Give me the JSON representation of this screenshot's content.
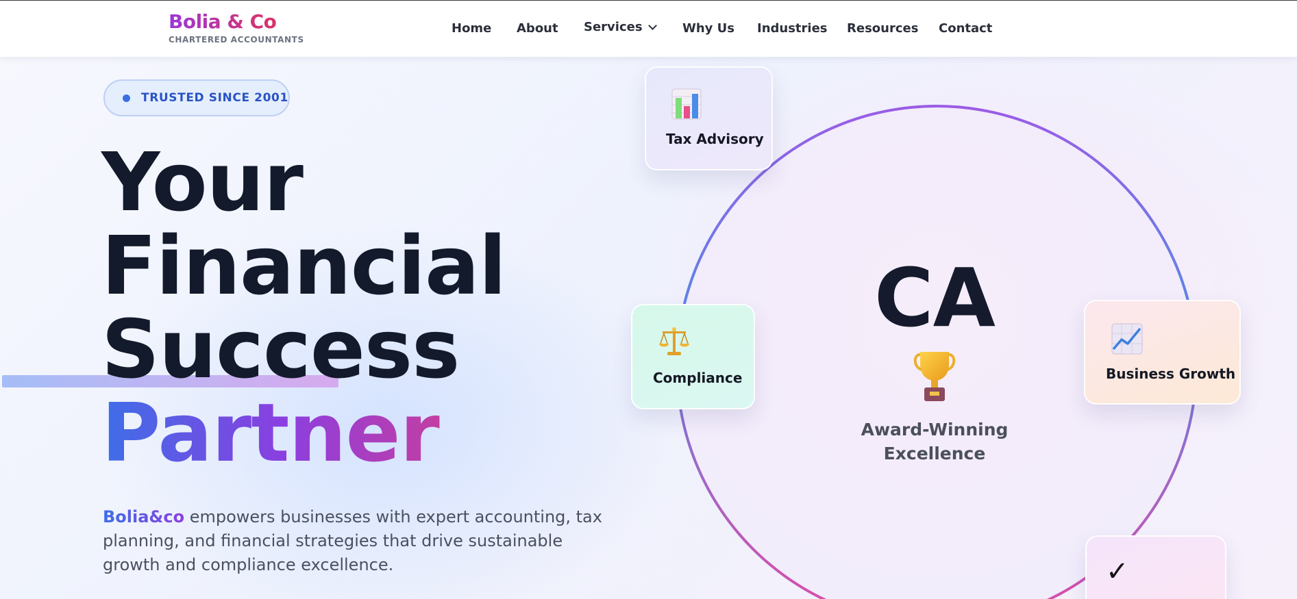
{
  "brand": {
    "name": "Bolia & Co",
    "subtitle": "CHARTERED ACCOUNTANTS"
  },
  "nav": {
    "items": [
      {
        "label": "Home"
      },
      {
        "label": "About"
      },
      {
        "label": "Services",
        "has_dropdown": true
      },
      {
        "label": "Why Us"
      },
      {
        "label": "Industries"
      },
      {
        "label": "Resources"
      },
      {
        "label": "Contact"
      }
    ]
  },
  "hero": {
    "badge": "TRUSTED SINCE 2001",
    "headline": {
      "line1": "Your",
      "line2": "Financial",
      "line3": "Success",
      "line4": "Partner"
    },
    "description": {
      "brand": "Bolia&co",
      "text": " empowers businesses with expert accounting, tax planning, and financial strategies that drive sustainable growth and compliance excellence."
    }
  },
  "visual": {
    "center_title": "CA",
    "center_icon": "trophy-icon",
    "center_caption_line1": "Award-Winning",
    "center_caption_line2": "Excellence",
    "cards": {
      "tax": {
        "label": "Tax Advisory",
        "icon": "bar-chart-icon"
      },
      "compliance": {
        "label": "Compliance",
        "icon": "balance-scale-icon"
      },
      "growth": {
        "label": "Business Growth",
        "icon": "trend-chart-icon"
      },
      "check": {
        "icon": "check-icon",
        "symbol": "✓"
      }
    }
  },
  "colors": {
    "brand_gradient_start": "#9b37d6",
    "brand_gradient_end": "#d6336f",
    "accent_blue": "#3d6ee8",
    "accent_purple": "#8b3fe0",
    "accent_pink": "#d93d8a",
    "badge_text": "#2a54c4",
    "headline_text": "#131a2b"
  }
}
